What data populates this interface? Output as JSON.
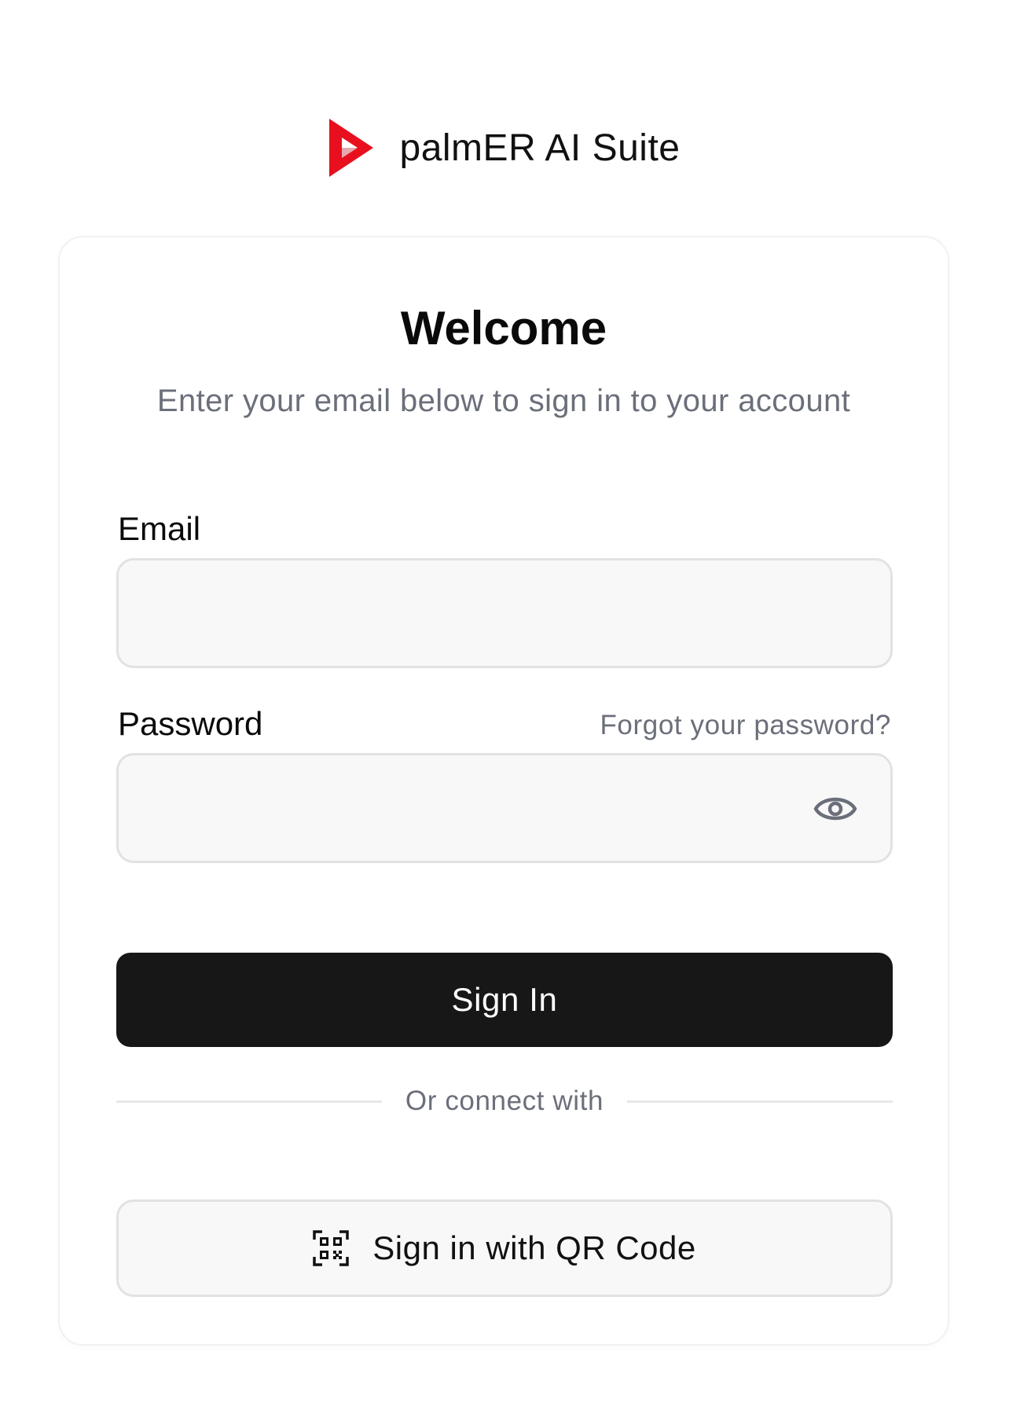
{
  "brand": {
    "name": "palmER AI Suite",
    "logo_icon": "red-play-arrow-logo",
    "accent_color": "#e8101e"
  },
  "login": {
    "title": "Welcome",
    "subtitle": "Enter your email below to sign in to your account",
    "email": {
      "label": "Email",
      "value": "",
      "placeholder": ""
    },
    "password": {
      "label": "Password",
      "value": "",
      "placeholder": "",
      "forgot_link": "Forgot your password?",
      "toggle_icon": "eye-icon"
    },
    "sign_in_label": "Sign In",
    "divider_text": "Or connect with",
    "qr_button": {
      "label": "Sign in with QR Code",
      "icon": "qr-code-icon"
    }
  }
}
